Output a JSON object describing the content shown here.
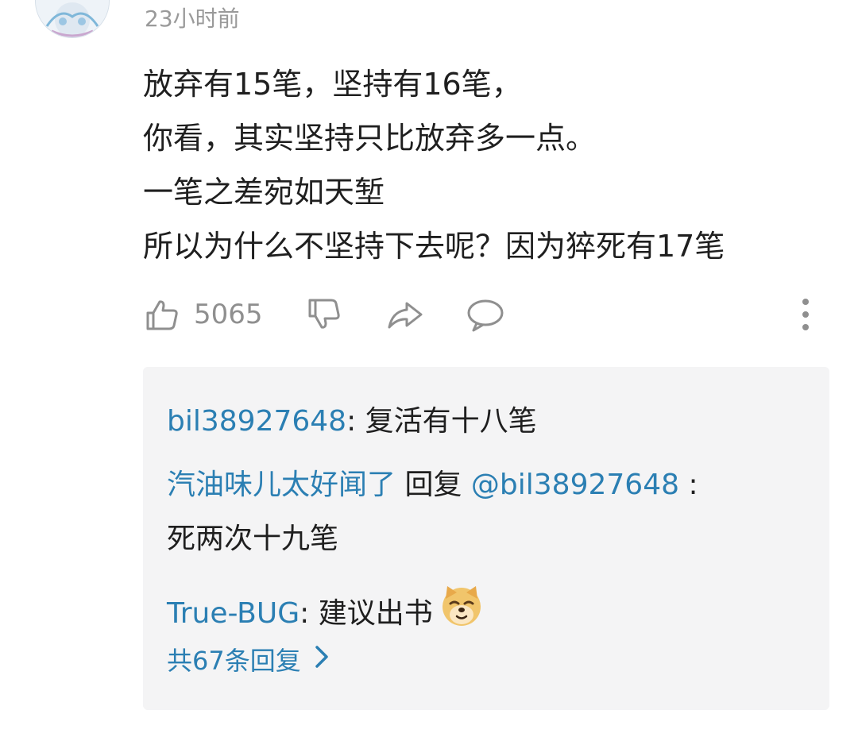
{
  "comment": {
    "timestamp": "23小时前",
    "lines": [
      "放弃有15笔，坚持有16笔，",
      "你看，其实坚持只比放弃多一点。",
      "一笔之差宛如天堑",
      "所以为什么不坚持下去呢？因为猝死有17笔"
    ],
    "like_count": "5065",
    "icons": {
      "avatar": "avatar",
      "like": "thumbs-up-icon",
      "dislike": "thumbs-down-icon",
      "share": "share-icon",
      "reply": "comment-bubble-icon",
      "more": "more-vertical-icon"
    }
  },
  "replies": {
    "items": [
      {
        "user": "bil38927648",
        "sep": ": ",
        "text": "复活有十八笔"
      },
      {
        "user": "汽油味儿太好闻了",
        "middle": " 回复 ",
        "mention": "@bil38927648",
        "sep": " :",
        "text": "死两次十九笔"
      },
      {
        "user": "True-BUG",
        "sep": ": ",
        "text": "建议出书",
        "emoji": "doge-emoji"
      }
    ],
    "more_label": "共67条回复",
    "more_icon": "chevron-right-icon"
  },
  "colors": {
    "link": "#2b7fb3",
    "muted": "#9a9a9a",
    "reply_bg": "#f4f4f5"
  }
}
